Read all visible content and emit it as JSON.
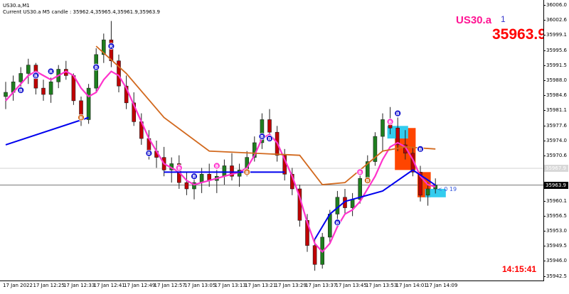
{
  "window": {
    "title": "US30.a,M1",
    "candle_info": "Current US30.a M5 candle : 35962.4,35965.4,35961.9,35963.9"
  },
  "symbol_label": "US30.a",
  "symbol_number": "1",
  "current_price": "35963.9",
  "clock": "14:15:41",
  "spread_label": "< 0 19",
  "ask_line_price": "35967.9",
  "price_axis": {
    "labels": [
      "36006.0",
      "36002.6",
      "35999.1",
      "35995.6",
      "35991.5",
      "35988.0",
      "35984.6",
      "35981.1",
      "35977.6",
      "35974.0",
      "35970.6",
      "35967.1",
      "35963.9",
      "35960.1",
      "35956.5",
      "35953.0",
      "35949.5",
      "35946.0",
      "35942.5"
    ]
  },
  "time_axis": {
    "labels": [
      "17 Jan 2022",
      "17 Jan 12:25",
      "17 Jan 12:33",
      "17 Jan 12:41",
      "17 Jan 12:49",
      "17 Jan 12:57",
      "17 Jan 13:05",
      "17 Jan 13:13",
      "17 Jan 13:21",
      "17 Jan 13:29",
      "17 Jan 13:37",
      "17 Jan 13:45",
      "17 Jan 13:53",
      "17 Jan 14:01",
      "17 Jan 14:09"
    ]
  },
  "colors": {
    "bull_candle": "#1e7e1e",
    "bear_candle": "#c00000",
    "ma_magenta": "#ff33cc",
    "ma_blue": "#0000ee",
    "ma_orange": "#d2691e",
    "box_orange": "#ff4500",
    "box_cyan": "#33ccee"
  },
  "chart_data": {
    "type": "candlestick",
    "ylim": [
      35941.0,
      36008.0
    ],
    "candles": [
      [
        35985.0,
        35988.5,
        35982.0,
        35986.0
      ],
      [
        35986.0,
        35990.0,
        35984.0,
        35988.5
      ],
      [
        35988.5,
        35992.0,
        35986.5,
        35990.5
      ],
      [
        35990.5,
        35994.0,
        35988.0,
        35992.5
      ],
      [
        35992.5,
        35993.0,
        35985.5,
        35987.0
      ],
      [
        35987.0,
        35989.0,
        35984.0,
        35985.5
      ],
      [
        35985.5,
        35989.5,
        35983.5,
        35988.5
      ],
      [
        35988.5,
        35992.5,
        35987.0,
        35991.5
      ],
      [
        35991.5,
        35993.5,
        35989.0,
        35990.0
      ],
      [
        35990.0,
        35990.5,
        35983.0,
        35984.0
      ],
      [
        35984.0,
        35985.0,
        35978.0,
        35979.5
      ],
      [
        35979.5,
        35988.0,
        35978.5,
        35987.0
      ],
      [
        35987.0,
        35996.5,
        35986.0,
        35995.0
      ],
      [
        35995.0,
        36000.0,
        35993.0,
        35998.5
      ],
      [
        35998.5,
        36003.0,
        35992.0,
        35993.5
      ],
      [
        35993.5,
        35995.0,
        35986.0,
        35987.5
      ],
      [
        35987.5,
        35990.0,
        35982.0,
        35983.5
      ],
      [
        35983.5,
        35986.0,
        35978.0,
        35979.0
      ],
      [
        35979.0,
        35981.0,
        35973.5,
        35975.0
      ],
      [
        35975.0,
        35977.0,
        35970.0,
        35972.0
      ],
      [
        35972.0,
        35974.5,
        35968.0,
        35970.5
      ],
      [
        35970.5,
        35973.0,
        35966.0,
        35967.5
      ],
      [
        35967.5,
        35970.5,
        35964.5,
        35969.0
      ],
      [
        35969.0,
        35971.0,
        35963.0,
        35964.5
      ],
      [
        35964.5,
        35967.0,
        35961.5,
        35963.0
      ],
      [
        35963.0,
        35966.0,
        35960.5,
        35964.5
      ],
      [
        35964.5,
        35968.0,
        35962.0,
        35966.5
      ],
      [
        35966.5,
        35969.0,
        35963.5,
        35965.0
      ],
      [
        35965.0,
        35967.5,
        35962.0,
        35966.0
      ],
      [
        35966.0,
        35970.0,
        35964.0,
        35968.5
      ],
      [
        35968.5,
        35971.5,
        35965.0,
        35966.0
      ],
      [
        35966.0,
        35969.0,
        35963.5,
        35967.5
      ],
      [
        35967.5,
        35972.0,
        35966.0,
        35970.5
      ],
      [
        35970.5,
        35975.5,
        35969.5,
        35974.0
      ],
      [
        35974.0,
        35981.0,
        35972.5,
        35979.5
      ],
      [
        35979.5,
        35982.0,
        35975.0,
        35976.5
      ],
      [
        35976.5,
        35978.0,
        35969.5,
        35971.0
      ],
      [
        35971.0,
        35972.5,
        35965.0,
        35966.5
      ],
      [
        35966.5,
        35968.0,
        35961.5,
        35963.0
      ],
      [
        35963.0,
        35964.0,
        35954.0,
        35955.5
      ],
      [
        35955.5,
        35957.0,
        35948.0,
        35949.5
      ],
      [
        35949.5,
        35951.0,
        35943.5,
        35945.0
      ],
      [
        35945.0,
        35952.5,
        35944.0,
        35951.5
      ],
      [
        35951.5,
        35958.0,
        35950.0,
        35957.0
      ],
      [
        35957.0,
        35962.5,
        35955.5,
        35961.0
      ],
      [
        35961.0,
        35963.0,
        35957.0,
        35958.5
      ],
      [
        35958.5,
        35962.0,
        35956.5,
        35960.5
      ],
      [
        35960.5,
        35966.5,
        35959.5,
        35965.5
      ],
      [
        35965.5,
        35971.0,
        35964.5,
        35969.5
      ],
      [
        35969.5,
        35976.5,
        35968.5,
        35975.5
      ],
      [
        35975.5,
        35981.0,
        35972.0,
        35979.5
      ],
      [
        35979.5,
        35982.5,
        35976.0,
        35977.5
      ],
      [
        35977.5,
        35980.0,
        35972.0,
        35973.5
      ],
      [
        35973.5,
        35977.0,
        35970.0,
        35971.5
      ],
      [
        35971.5,
        35973.0,
        35966.0,
        35967.0
      ],
      [
        35967.0,
        35968.5,
        35960.0,
        35961.5
      ],
      [
        35961.5,
        35964.5,
        35959.0,
        35963.0
      ],
      [
        35963.0,
        35965.5,
        35961.9,
        35963.9
      ]
    ],
    "ma_magenta": [
      35984,
      35986,
      35988,
      35990,
      35991,
      35990,
      35989,
      35990,
      35991,
      35990,
      35987,
      35985,
      35986,
      35989,
      35991,
      35990,
      35987,
      35983,
      35979,
      35975,
      35972,
      35969,
      35968,
      35967,
      35965,
      35964,
      35964.5,
      35965,
      35965.5,
      35966,
      35966.5,
      35967,
      35968,
      35971,
      35975,
      35976,
      35974,
      35970,
      35966,
      35961,
      35955,
      35950,
      35948,
      35950,
      35954,
      35957,
      35958,
      35960,
      35963,
      35966,
      35970,
      35973,
      35974,
      35973,
      35970,
      35966,
      35964,
      35963.5
    ],
    "ma_blue": [
      [
        0,
        35973.5
      ],
      [
        11,
        35980.0
      ],
      null,
      [
        21,
        35967.0
      ],
      [
        32,
        35967.0
      ],
      [
        37,
        35967.0
      ],
      null,
      [
        41,
        35951.0
      ],
      [
        43,
        35957.0
      ],
      [
        45,
        35960.0
      ],
      [
        50,
        35962.5
      ],
      [
        54,
        35967.5
      ],
      [
        57,
        35963.9
      ]
    ],
    "ma_orange": [
      [
        12,
        35997.0
      ],
      [
        16,
        35990.5
      ],
      [
        21,
        35980.0
      ],
      [
        27,
        35972.0
      ],
      [
        33,
        35971.5
      ],
      [
        39,
        35971.0
      ],
      [
        42,
        35964.0
      ],
      [
        45,
        35964.5
      ],
      [
        50,
        35972.0
      ],
      [
        53,
        35973.0
      ],
      [
        57,
        35972.5
      ]
    ],
    "boxes": [
      {
        "x0": 52,
        "x1": 54,
        "top": 35977.5,
        "bottom": 35967.5,
        "color": "box_orange"
      },
      {
        "x0": 51,
        "x1": 53,
        "top": 35978.0,
        "bottom": 35975.0,
        "color": "box_cyan"
      },
      {
        "x0": 55,
        "x1": 56,
        "top": 35967.0,
        "bottom": 35961.0,
        "color": "box_orange"
      },
      {
        "x0": 56,
        "x1": 58,
        "top": 35963.0,
        "bottom": 35961.0,
        "color": "box_cyan"
      }
    ],
    "markers": [
      {
        "i": 2,
        "y": 35986.5,
        "label": "B",
        "color": "#1111cc"
      },
      {
        "i": 4,
        "y": 35990.0,
        "label": "B",
        "color": "#1111cc"
      },
      {
        "i": 6,
        "y": 35991.0,
        "label": "R",
        "color": "#1111cc"
      },
      {
        "i": 10,
        "y": 35980.0,
        "label": "B",
        "color": "#d2691e"
      },
      {
        "i": 12,
        "y": 35992.0,
        "label": "B",
        "color": "#1111cc"
      },
      {
        "i": 14,
        "y": 35997.0,
        "label": "R",
        "color": "#1111cc"
      },
      {
        "i": 19,
        "y": 35971.5,
        "label": "B",
        "color": "#1111cc"
      },
      {
        "i": 23,
        "y": 35968.0,
        "label": "B",
        "color": "#ff33cc"
      },
      {
        "i": 25,
        "y": 35966.0,
        "label": "B",
        "color": "#1111cc"
      },
      {
        "i": 28,
        "y": 35968.5,
        "label": "B",
        "color": "#ff33cc"
      },
      {
        "i": 32,
        "y": 35967.0,
        "label": "B",
        "color": "#d2691e"
      },
      {
        "i": 34,
        "y": 35975.5,
        "label": "B",
        "color": "#1111cc"
      },
      {
        "i": 35,
        "y": 35975.0,
        "label": "B",
        "color": "#1111cc"
      },
      {
        "i": 44,
        "y": 35955.0,
        "label": "B",
        "color": "#1111cc"
      },
      {
        "i": 47,
        "y": 35967.0,
        "label": "B",
        "color": "#ff33cc"
      },
      {
        "i": 48,
        "y": 35965.0,
        "label": "B",
        "color": "#d2691e"
      },
      {
        "i": 51,
        "y": 35979.0,
        "label": "B",
        "color": "#ff33cc"
      },
      {
        "i": 52,
        "y": 35981.0,
        "label": "B",
        "color": "#1111cc"
      },
      {
        "i": 55,
        "y": 35972.5,
        "label": "B",
        "color": "#1111cc"
      }
    ]
  }
}
